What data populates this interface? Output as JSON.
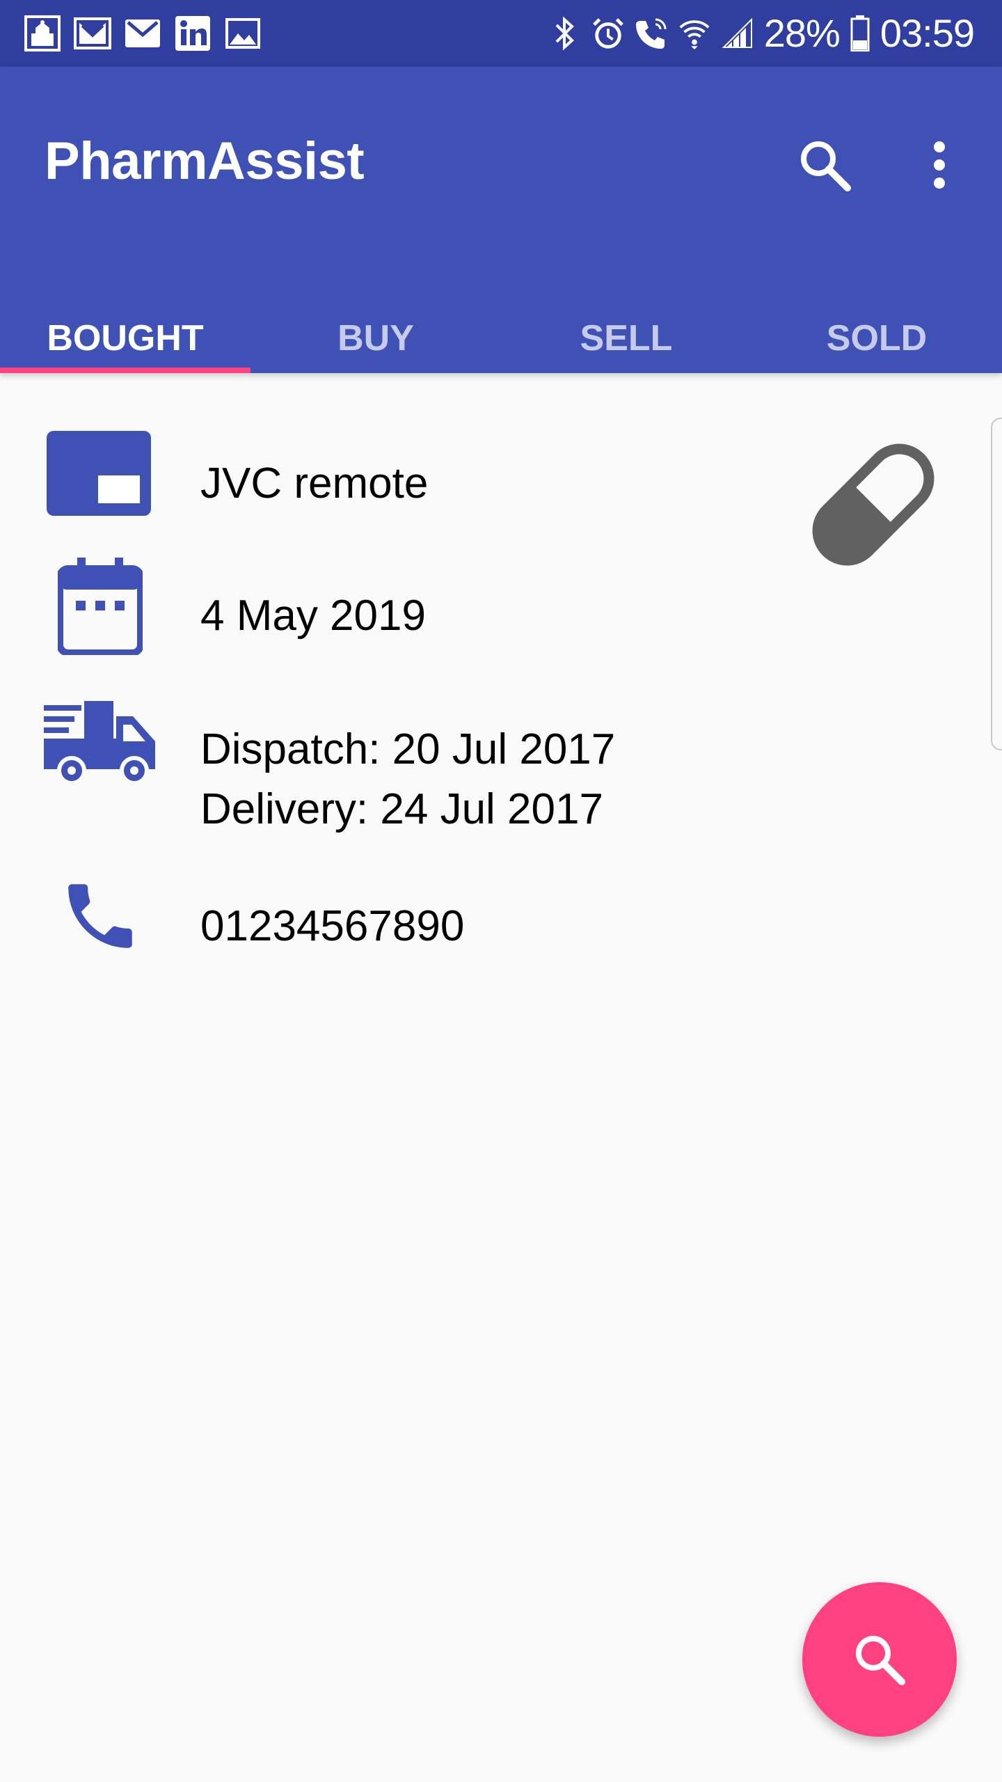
{
  "status_bar": {
    "battery": "28%",
    "time": "03:59"
  },
  "app_bar": {
    "title": "PharmAssist",
    "tabs": [
      {
        "label": "BOUGHT",
        "active": true
      },
      {
        "label": "BUY",
        "active": false
      },
      {
        "label": "SELL",
        "active": false
      },
      {
        "label": "SOLD",
        "active": false
      }
    ]
  },
  "details": {
    "item_name": "JVC remote",
    "date": "4 May 2019",
    "dispatch": "Dispatch: 20 Jul 2017",
    "delivery": "Delivery: 24 Jul 2017",
    "phone": "01234567890"
  },
  "colors": {
    "primary": "#3f51b5",
    "primary_dark": "#303f9f",
    "accent": "#ff4081",
    "icon_grey": "#616161"
  }
}
